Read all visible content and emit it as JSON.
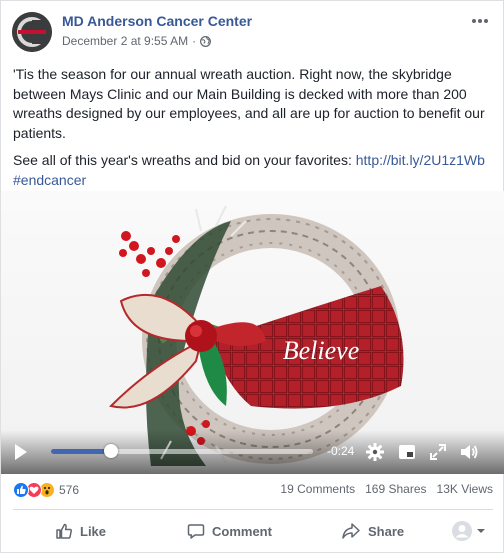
{
  "post": {
    "page_name": "MD Anderson Cancer Center",
    "date": "December 2 at 9:55 AM",
    "separator": "·",
    "more_icon": "more-horizontal-icon",
    "paragraph1": "'Tis the season for our annual wreath auction. Right now, the skybridge between Mays Clinic and our Main Building is decked with more than 200 wreaths designed by our employees, and all are up for auction to benefit our patients.",
    "paragraph2_prefix": "See all of this year's wreaths and bid on your favorites: ",
    "paragraph2_link": "http://bit.ly/2U1z1Wb",
    "hashtag": "#endcancer"
  },
  "video": {
    "ribbon_text": "Believe",
    "time_remaining": "-0:24",
    "progress": 0.23,
    "colors": {
      "progress": "#4267b2",
      "ribbon": "#b3202a"
    }
  },
  "stats": {
    "reaction_count": "576",
    "reaction_icons": [
      "like-icon",
      "love-icon",
      "wow-icon"
    ],
    "comments": "19 Comments",
    "shares": "169 Shares",
    "views": "13K Views"
  },
  "actions": {
    "like_label": "Like",
    "comment_label": "Comment",
    "share_label": "Share"
  },
  "colors": {
    "brand_link": "#385898",
    "secondary_text": "#606770",
    "like_blue": "#1877f2"
  }
}
